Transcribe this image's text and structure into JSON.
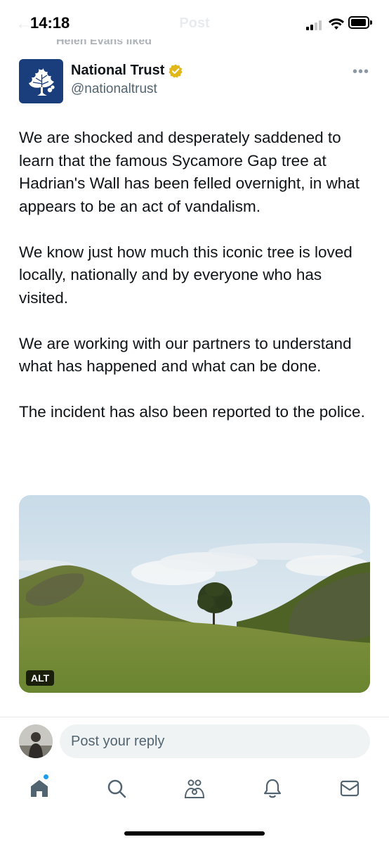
{
  "status_bar": {
    "time": "14:18"
  },
  "header": {
    "title": "Post",
    "back": "←"
  },
  "social_context": "Helen Evans liked",
  "author": {
    "name": "National Trust",
    "handle": "@nationaltrust",
    "verified": true
  },
  "more_label": "•••",
  "tweet": {
    "paragraphs": [
      "We are shocked and desperately saddened to learn that the famous Sycamore Gap tree at Hadrian's Wall has been felled overnight, in what appears to be an act of vandalism.",
      "We know just how much this iconic tree is loved locally, nationally and by everyone who has visited.",
      "We are working with our partners to understand what has happened and what can be done.",
      "The incident has also been reported to the police."
    ]
  },
  "media": {
    "alt_label": "ALT"
  },
  "reply": {
    "placeholder": "Post your reply"
  },
  "nav": {
    "items": [
      "home-icon",
      "search-icon",
      "communities-icon",
      "notifications-icon",
      "messages-icon"
    ],
    "home_has_dot": true
  },
  "colors": {
    "accent": "#1d9bf0",
    "verified_gold": "#e2b719",
    "logo_blue": "#1a3d7c"
  }
}
